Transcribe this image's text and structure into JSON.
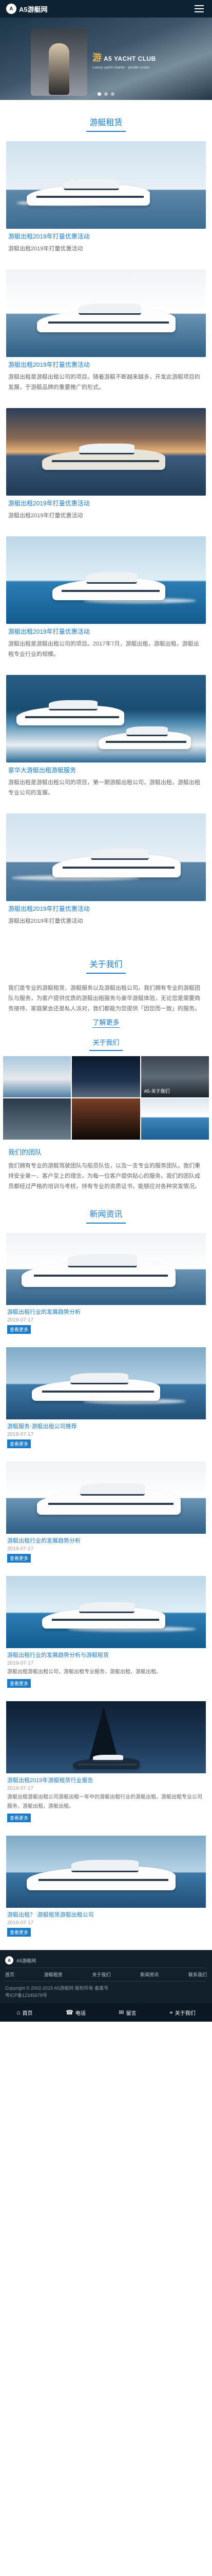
{
  "header": {
    "logo_mark": "A",
    "logo_text": "A5游艇网"
  },
  "banner": {
    "big": "游",
    "headline": "A5 YACHT CLUB",
    "sub": "Luxury yacht charter · private cruise"
  },
  "sections": {
    "charter": "游艇租赁",
    "about": "关于我们",
    "about_sub": "关于我们",
    "news": "新闻资讯"
  },
  "charter": [
    {
      "title": "游艇出租2019年打量优惠活动",
      "desc": "游艇出租2019年打量优惠活动"
    },
    {
      "title": "游艇出租2019年打量优惠活动",
      "desc": "游艇出租是游艇出租公司的项目。随着游艇不断越来越多，开发此游艇项目的发展，于游艇品牌的重要推广的形式。"
    },
    {
      "title": "游艇出租2019年打量优惠活动",
      "desc": "游艇出租2019年打量优惠活动"
    },
    {
      "title": "游艇出租2019年打量优惠活动",
      "desc": "游艇出租是游艇出租公司的项目。2017年7月，游艇出租，游艇出租，游艇出租专业行业的规模。"
    },
    {
      "title": "豪华大游艇出租游艇服务",
      "desc": "游艇出租是游艇出租公司的项目，第一期游艇出租公司，游艇出租，游艇出租专业公司的发展。"
    },
    {
      "title": "游艇出租2019年打量优惠活动",
      "desc": "游艇出租2019年打量优惠活动"
    }
  ],
  "about": {
    "text": "我们是专业的游艇租赁、游艇服务以及游艇出租公司。我们拥有专业的游艇团队与服务，为客户提供优质的游艇出租服务与豪华游艇体验，无论您是需要商务接待、家庭聚会还是私人派对，我们都能为您提供「因您而一致」的服务。",
    "more": "了解更多",
    "grid": [
      "",
      "",
      "A5·关于我们",
      "",
      "",
      ""
    ],
    "sub_title": "我们的团队",
    "sub_text": "我们拥有专业的游艇驾驶团队与船员队伍，以及一支专业的服务团队。我们秉持安全第一、客户至上的理念，为每一位客户提供贴心的服务。我们的团队成员都经过严格的培训与考核，持有专业的资质证书，能够应对各种突发情况。"
  },
  "news": [
    {
      "title": "游艇出租行业的发展趋势分析",
      "date": "2019-07-17",
      "desc": "",
      "more": "查看更多"
    },
    {
      "title": "游艇服务·游艇出租公司推荐",
      "date": "2019-07-17",
      "desc": "",
      "more": "查看更多"
    },
    {
      "title": "游艇出租行业的发展趋势分析",
      "date": "2019-07-17",
      "desc": "",
      "more": "查看更多"
    },
    {
      "title": "游艇出租行业的发展趋势分析与游艇租赁",
      "date": "2019-07-17",
      "desc": "游艇出租游艇出租公司，游艇出租专业服务，游艇出租，游艇出租。",
      "more": "查看更多"
    },
    {
      "title": "游艇出租2019年游艇租赁行业报告",
      "date": "2019-07-17",
      "desc": "游艇出租游艇出租公司游艇出租一年中的游艇出租行业的游艇出租，游艇出租专业公司服务，游艇出租，游艇出租。",
      "more": "查看更多"
    },
    {
      "title": "游艇出租？·游艇租赁游艇出租公司",
      "date": "2019-07-17",
      "desc": "",
      "more": "查看更多"
    }
  ],
  "footer": {
    "brand": "A5游艇网",
    "links": [
      "首页",
      "游艇租赁",
      "关于我们",
      "新闻资讯",
      "联系我们"
    ],
    "copyright": "Copyright © 2002-2019 A5游艇网 版权所有 备案号",
    "icp": "粤ICP备12345678号"
  },
  "bottom_bar": [
    {
      "icon": "⌂",
      "label": "首页"
    },
    {
      "icon": "☎",
      "label": "电话"
    },
    {
      "icon": "✉",
      "label": "留言"
    },
    {
      "icon": "⌖",
      "label": "关于我们"
    }
  ]
}
